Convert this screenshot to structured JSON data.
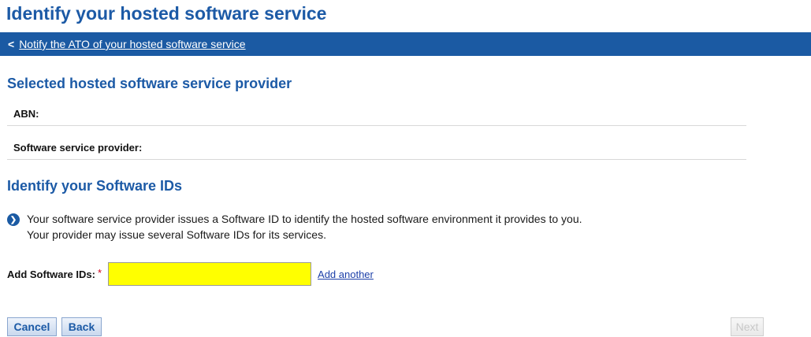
{
  "page": {
    "title": "Identify your hosted software service"
  },
  "nav": {
    "back_link": "Notify the ATO of your hosted software service",
    "chevron": "<"
  },
  "provider_section": {
    "title": "Selected hosted software service provider",
    "abn_label": "ABN:",
    "provider_label": "Software service provider:"
  },
  "software_ids_section": {
    "title": "Identify your Software IDs",
    "info_icon": "info-chevron-icon",
    "info_line1": "Your software service provider issues a Software ID to identify the hosted software environment it provides to you.",
    "info_line2": "Your provider may issue several Software IDs for its services.",
    "add_label": "Add Software IDs:",
    "required_marker": "*",
    "input_value": "",
    "input_highlight_color": "#ffff00",
    "add_another_label": "Add another"
  },
  "actions": {
    "cancel_label": "Cancel",
    "back_label": "Back",
    "next_label": "Next",
    "next_disabled": true
  },
  "colors": {
    "brand_blue": "#1b5aa3",
    "heading_blue": "#1c5aa6",
    "required_red": "#d0021b"
  }
}
